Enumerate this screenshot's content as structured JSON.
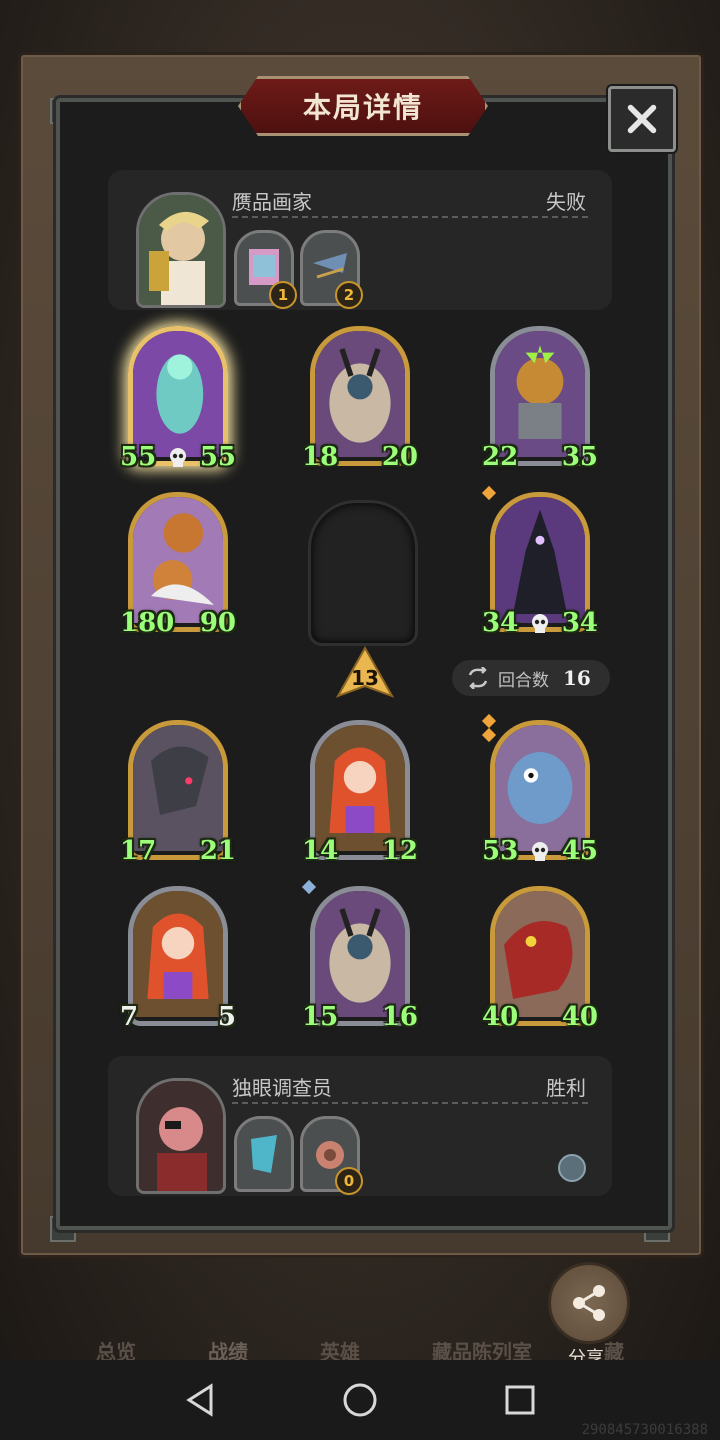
{
  "dialog": {
    "title": "本局详情"
  },
  "opponent": {
    "name": "赝品画家",
    "result": "失败",
    "relics": [
      {
        "badge": "1"
      },
      {
        "badge": "2"
      }
    ]
  },
  "opponent_board": [
    {
      "atk": "55",
      "hp": "55",
      "skull": true,
      "frame": "gold-glow"
    },
    {
      "atk": "18",
      "hp": "20",
      "frame": "gold"
    },
    {
      "atk": "22",
      "hp": "35",
      "frame": "silver"
    },
    {
      "atk": "180",
      "hp": "90",
      "frame": "gold"
    },
    {
      "atk": "34",
      "hp": "34",
      "skull": true,
      "frame": "gold"
    }
  ],
  "tavern_tier": "13",
  "turns": {
    "label": "回合数",
    "value": "16"
  },
  "player_board": [
    {
      "atk": "17",
      "hp": "21",
      "frame": "gold"
    },
    {
      "atk": "14",
      "hp": "12",
      "frame": "silver"
    },
    {
      "atk": "53",
      "hp": "45",
      "skull": true,
      "frame": "gold"
    },
    {
      "atk": "7",
      "hp": "5",
      "frame": "silver"
    },
    {
      "atk": "15",
      "hp": "16",
      "frame": "silver"
    },
    {
      "atk": "40",
      "hp": "40",
      "frame": "gold"
    }
  ],
  "player": {
    "name": "独眼调查员",
    "result": "胜利",
    "relics": [
      {
        "badge": ""
      },
      {
        "badge": "0"
      }
    ]
  },
  "share": {
    "label": "分享"
  },
  "background_tabs": [
    "总览",
    "战绩",
    "英雄",
    "藏品陈列室",
    "藏"
  ],
  "device_id": "290845730016388",
  "colors": {
    "banner": "#6e1b18",
    "stat_green": "#9cff7a",
    "gold_frame": "#c99a3b",
    "silver_frame": "#8a8d96"
  }
}
